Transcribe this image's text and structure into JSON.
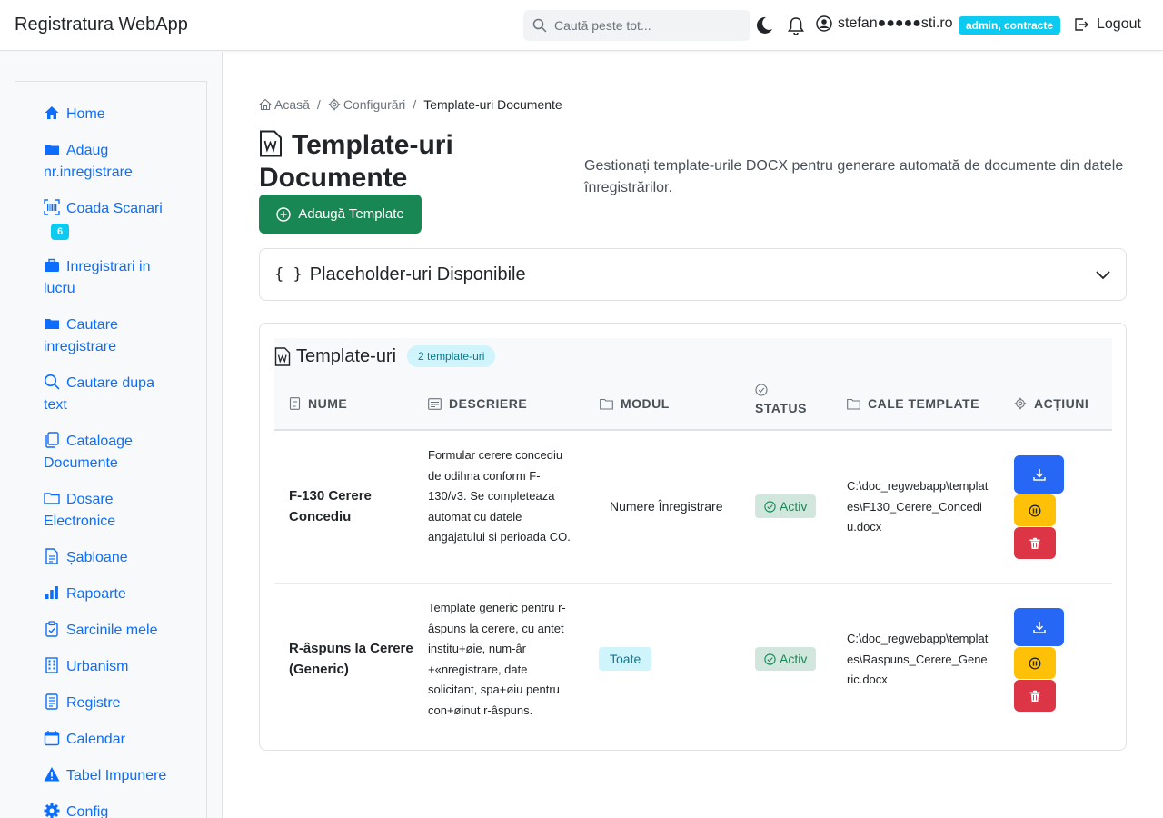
{
  "app": {
    "title": "Registratura WebApp"
  },
  "header": {
    "search_placeholder": "Caută peste tot...",
    "user_email": "stefan●●●●●sti.ro",
    "role_badge": "admin, contracte",
    "logout_label": "Logout"
  },
  "sidebar": {
    "items": [
      {
        "label": "Home",
        "icon": "house-icon"
      },
      {
        "label": "Adaug nr.inregistrare",
        "icon": "folder-icon"
      },
      {
        "label": "Coada Scanari",
        "icon": "barcode-icon",
        "badge": "6"
      },
      {
        "label": "Inregistrari in lucru",
        "icon": "briefcase-icon"
      },
      {
        "label": "Cautare inregistrare",
        "icon": "folder-icon"
      },
      {
        "label": "Cautare dupa text",
        "icon": "search-icon"
      },
      {
        "label": "Cataloage Documente",
        "icon": "files-icon"
      },
      {
        "label": "Dosare Electronice",
        "icon": "folder-outline-icon"
      },
      {
        "label": "Șabloane",
        "icon": "file-text-icon"
      },
      {
        "label": "Rapoarte",
        "icon": "bar-chart-icon"
      },
      {
        "label": "Sarcinile mele",
        "icon": "clipboard-check-icon"
      },
      {
        "label": "Urbanism",
        "icon": "building-icon"
      },
      {
        "label": "Registre",
        "icon": "journal-icon"
      },
      {
        "label": "Calendar",
        "icon": "calendar-icon"
      },
      {
        "label": "Tabel Impunere",
        "icon": "warning-icon"
      },
      {
        "label": "Config",
        "icon": "gear-icon"
      }
    ]
  },
  "breadcrumb": {
    "home": "Acasă",
    "config": "Configurări",
    "current": "Template-uri Documente"
  },
  "page": {
    "title": "Template-uri Documente",
    "subtitle": "Gestionați template-urile DOCX pentru generare automată de documente din datele înregistrărilor.",
    "add_button": "Adaugă Template"
  },
  "placeholders": {
    "title": "Placeholder-uri Disponibile",
    "braces": "{ }"
  },
  "templates": {
    "title": "Template-uri",
    "count_badge": "2 template-uri",
    "columns": [
      "NUME",
      "DESCRIERE",
      "MODUL",
      "STATUS",
      "CALE TEMPLATE",
      "ACȚIUNI"
    ],
    "rows": [
      {
        "name": "F-130 Cerere Concediu",
        "description": "Formular cerere concediu de odihna conform F-130/v3. Se completeaza automat cu datele angajatului si perioada CO.",
        "module": "Numere Înregistrare",
        "status": "Activ",
        "path": "C:\\doc_regwebapp\\templates\\F130_Cerere_Concediu.docx"
      },
      {
        "name": "R-âspuns la Cerere (Generic)",
        "description": "Template generic pentru r-âspuns la cerere, cu antet institu+øie, num-âr +«nregistrare, date solicitant, spa+øiu pentru con+øinut r-âspuns.",
        "module": "Toate",
        "status": "Activ",
        "path": "C:\\doc_regwebapp\\templates\\Raspuns_Cerere_Generic.docx"
      }
    ]
  },
  "colors": {
    "primary": "#0d6efd",
    "success": "#198754",
    "info": "#0dcaf0",
    "warning": "#ffc107",
    "danger": "#dc3545"
  }
}
